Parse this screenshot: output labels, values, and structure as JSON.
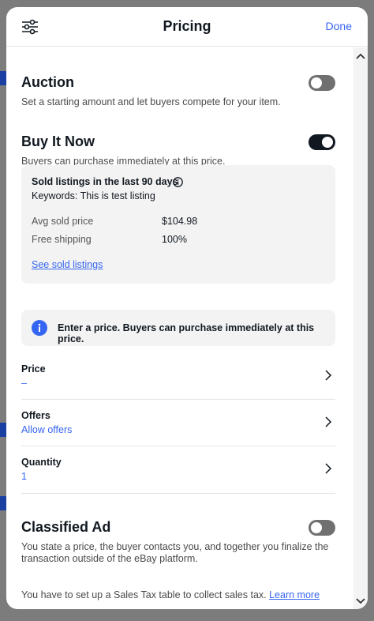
{
  "header": {
    "title": "Pricing",
    "done_label": "Done"
  },
  "auction": {
    "title": "Auction",
    "description": "Set a starting amount and let buyers compete for your item.",
    "toggle_on": false
  },
  "buy_it_now": {
    "title": "Buy It Now",
    "description": "Buyers can purchase immediately at this price.",
    "toggle_on": true,
    "sold_listings": {
      "heading": "Sold listings in the last 90 days",
      "keywords": "Keywords: This is test listing",
      "stats": [
        {
          "label": "Avg sold price",
          "value": "$104.98"
        },
        {
          "label": "Free shipping",
          "value": "100%"
        }
      ],
      "link_label": "See sold listings"
    }
  },
  "notice": {
    "text": "Enter a price. Buyers can purchase immediately at this price."
  },
  "rows": [
    {
      "label": "Price",
      "value": "–"
    },
    {
      "label": "Offers",
      "value": "Allow offers"
    },
    {
      "label": "Quantity",
      "value": "1"
    }
  ],
  "classified_ad": {
    "title": "Classified Ad",
    "description": "You state a price, the buyer contacts you, and together you finalize the transaction outside of the eBay platform.",
    "toggle_on": false
  },
  "sales_tax": {
    "text": "You have to set up a Sales Tax table to collect sales tax.",
    "link_label": "Learn more"
  },
  "colors": {
    "accent": "#3665f3",
    "toggle_on": "#111820",
    "toggle_off": "#707070"
  },
  "icons": {
    "filter": "sliders-icon",
    "info": "info-circle-icon",
    "chevron": "chevron-right-icon"
  }
}
